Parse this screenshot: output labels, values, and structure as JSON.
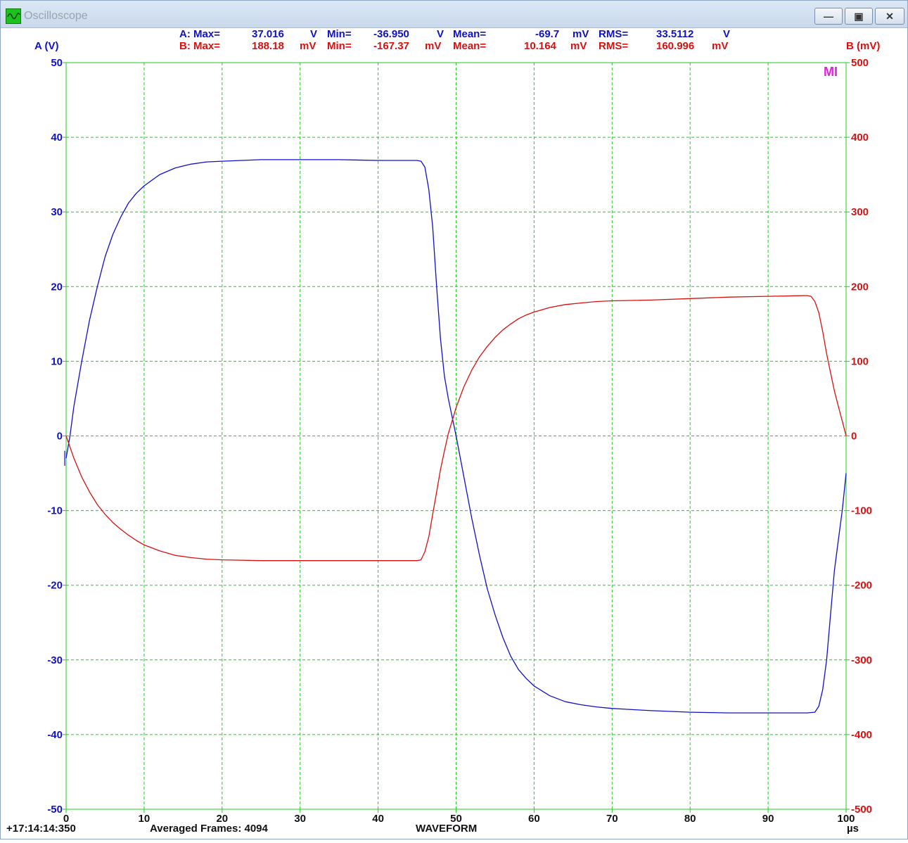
{
  "window": {
    "title": "Oscilloscope",
    "minimize_glyph": "—",
    "maximize_glyph": "▣",
    "close_glyph": "✕"
  },
  "colors": {
    "channel_a": "#1010c8",
    "channel_b": "#d81010",
    "grid": "#22cc22",
    "marker": "#e020e0"
  },
  "stats": {
    "a": {
      "max_label": "A: Max=",
      "max": "37.016",
      "max_unit": "V",
      "min_label": "Min=",
      "min": "-36.950",
      "min_unit": "V",
      "mean_label": "Mean=",
      "mean": "-69.7",
      "mean_unit": "mV",
      "rms_label": "RMS=",
      "rms": "33.5112",
      "rms_unit": "V"
    },
    "b": {
      "max_label": "B: Max=",
      "max": "188.18",
      "max_unit": "mV",
      "min_label": "Min=",
      "min": "-167.37",
      "min_unit": "mV",
      "mean_label": "Mean=",
      "mean": "10.164",
      "mean_unit": "mV",
      "rms_label": "RMS=",
      "rms": "160.996",
      "rms_unit": "mV"
    }
  },
  "marker_label": "MI",
  "footer": {
    "timestamp": "+17:14:14:350",
    "frames": "Averaged Frames: 4094",
    "mode": "WAVEFORM"
  },
  "chart_data": {
    "type": "line",
    "xlabel": "µs",
    "ylabel_left": "A (V)",
    "ylabel_right": "B (mV)",
    "xlim": [
      0,
      100
    ],
    "ylim_left": [
      -50,
      50
    ],
    "ylim_right": [
      -500,
      500
    ],
    "grid": true,
    "x_ticks": [
      "0",
      "10",
      "20",
      "30",
      "40",
      "50",
      "60",
      "70",
      "80",
      "90",
      "100"
    ],
    "y_ticks_left": [
      "50",
      "40",
      "30",
      "20",
      "10",
      "0",
      "-10",
      "-20",
      "-30",
      "-40",
      "-50"
    ],
    "y_ticks_right": [
      "500",
      "400",
      "300",
      "200",
      "100",
      "0",
      "-100",
      "-200",
      "-300",
      "-400",
      "-500"
    ],
    "series": [
      {
        "axis": "left",
        "points": [
          [
            0,
            -3
          ],
          [
            0.5,
            0
          ],
          [
            1,
            4
          ],
          [
            2,
            10
          ],
          [
            3,
            15.5
          ],
          [
            4,
            20
          ],
          [
            5,
            24
          ],
          [
            6,
            27
          ],
          [
            7,
            29.3
          ],
          [
            8,
            31.2
          ],
          [
            9,
            32.5
          ],
          [
            10,
            33.5
          ],
          [
            12,
            35
          ],
          [
            14,
            35.9
          ],
          [
            16,
            36.4
          ],
          [
            18,
            36.7
          ],
          [
            20,
            36.8
          ],
          [
            25,
            37
          ],
          [
            30,
            37
          ],
          [
            35,
            37
          ],
          [
            40,
            36.9
          ],
          [
            45,
            36.9
          ],
          [
            45.5,
            36.8
          ],
          [
            46,
            36
          ],
          [
            46.5,
            33
          ],
          [
            47,
            28
          ],
          [
            47.5,
            20
          ],
          [
            48,
            13
          ],
          [
            48.5,
            8
          ],
          [
            49,
            5
          ],
          [
            50,
            0
          ],
          [
            51,
            -5.5
          ],
          [
            52,
            -11
          ],
          [
            53,
            -16
          ],
          [
            54,
            -20.5
          ],
          [
            55,
            -24
          ],
          [
            56,
            -27
          ],
          [
            57,
            -29.5
          ],
          [
            58,
            -31.3
          ],
          [
            59,
            -32.5
          ],
          [
            60,
            -33.5
          ],
          [
            62,
            -34.8
          ],
          [
            64,
            -35.6
          ],
          [
            66,
            -36
          ],
          [
            68,
            -36.3
          ],
          [
            70,
            -36.5
          ],
          [
            75,
            -36.8
          ],
          [
            80,
            -37
          ],
          [
            85,
            -37.1
          ],
          [
            90,
            -37.1
          ],
          [
            95,
            -37.1
          ],
          [
            96,
            -37
          ],
          [
            96.5,
            -36.2
          ],
          [
            97,
            -34
          ],
          [
            97.5,
            -30
          ],
          [
            98,
            -24
          ],
          [
            98.5,
            -18
          ],
          [
            99,
            -14
          ],
          [
            99.5,
            -10
          ],
          [
            100,
            -5
          ]
        ]
      },
      {
        "axis": "right",
        "points": [
          [
            0,
            0
          ],
          [
            1,
            -30
          ],
          [
            2,
            -55
          ],
          [
            3,
            -75
          ],
          [
            4,
            -92
          ],
          [
            5,
            -105
          ],
          [
            6,
            -116
          ],
          [
            7,
            -125
          ],
          [
            8,
            -133
          ],
          [
            9,
            -140
          ],
          [
            10,
            -146
          ],
          [
            12,
            -154
          ],
          [
            14,
            -160
          ],
          [
            16,
            -163
          ],
          [
            18,
            -165
          ],
          [
            20,
            -166
          ],
          [
            25,
            -167
          ],
          [
            30,
            -167
          ],
          [
            35,
            -167
          ],
          [
            40,
            -167
          ],
          [
            45,
            -167
          ],
          [
            45.5,
            -166
          ],
          [
            46,
            -155
          ],
          [
            46.5,
            -135
          ],
          [
            47,
            -105
          ],
          [
            47.5,
            -75
          ],
          [
            48,
            -45
          ],
          [
            48.5,
            -20
          ],
          [
            49,
            3
          ],
          [
            50,
            38
          ],
          [
            51,
            66
          ],
          [
            52,
            88
          ],
          [
            53,
            106
          ],
          [
            54,
            120
          ],
          [
            55,
            132
          ],
          [
            56,
            142
          ],
          [
            57,
            150
          ],
          [
            58,
            157
          ],
          [
            59,
            162
          ],
          [
            60,
            166
          ],
          [
            62,
            172
          ],
          [
            64,
            176
          ],
          [
            66,
            178
          ],
          [
            68,
            180
          ],
          [
            70,
            181
          ],
          [
            75,
            182
          ],
          [
            80,
            184
          ],
          [
            85,
            186
          ],
          [
            90,
            187
          ],
          [
            95,
            188
          ],
          [
            95.5,
            187
          ],
          [
            96,
            180
          ],
          [
            96.5,
            165
          ],
          [
            97,
            140
          ],
          [
            97.5,
            110
          ],
          [
            98,
            85
          ],
          [
            98.5,
            60
          ],
          [
            99,
            40
          ],
          [
            99.5,
            20
          ],
          [
            100,
            0
          ]
        ]
      }
    ]
  }
}
